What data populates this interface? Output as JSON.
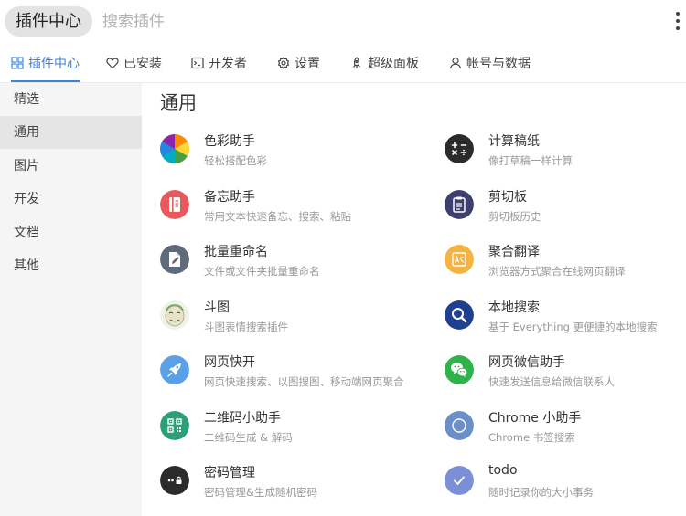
{
  "header": {
    "badge": "插件中心",
    "search_placeholder": "搜索插件"
  },
  "tabs": [
    {
      "label": "插件中心",
      "icon": "grid-icon"
    },
    {
      "label": "已安装",
      "icon": "heart-icon"
    },
    {
      "label": "开发者",
      "icon": "terminal-icon"
    },
    {
      "label": "设置",
      "icon": "gear-icon"
    },
    {
      "label": "超级面板",
      "icon": "rocket-icon"
    },
    {
      "label": "帐号与数据",
      "icon": "user-icon"
    }
  ],
  "sidebar": {
    "items": [
      {
        "label": "精选"
      },
      {
        "label": "通用"
      },
      {
        "label": "图片"
      },
      {
        "label": "开发"
      },
      {
        "label": "文档"
      },
      {
        "label": "其他"
      }
    ]
  },
  "main": {
    "title": "通用",
    "plugins": [
      {
        "name": "色彩助手",
        "desc": "轻松搭配色彩",
        "icon": "color-wheel-icon"
      },
      {
        "name": "计算稿纸",
        "desc": "像打草稿一样计算",
        "icon": "calculator-icon"
      },
      {
        "name": "备忘助手",
        "desc": "常用文本快速备忘、搜索、粘贴",
        "icon": "notebook-icon"
      },
      {
        "name": "剪切板",
        "desc": "剪切板历史",
        "icon": "clipboard-icon"
      },
      {
        "name": "批量重命名",
        "desc": "文件或文件夹批量重命名",
        "icon": "rename-file-icon"
      },
      {
        "name": "聚合翻译",
        "desc": "浏览器方式聚合在线网页翻译",
        "icon": "translate-icon"
      },
      {
        "name": "斗图",
        "desc": "斗图表情搜索插件",
        "icon": "meme-face-icon"
      },
      {
        "name": "本地搜索",
        "desc": "基于 Everything 更便捷的本地搜索",
        "icon": "magnifier-icon"
      },
      {
        "name": "网页快开",
        "desc": "网页快速搜索、以图搜图、移动端网页聚合",
        "icon": "rocket-icon"
      },
      {
        "name": "网页微信助手",
        "desc": "快速发送信息给微信联系人",
        "icon": "wechat-icon"
      },
      {
        "name": "二维码小助手",
        "desc": "二维码生成 & 解码",
        "icon": "qr-code-icon"
      },
      {
        "name": "Chrome 小助手",
        "desc": "Chrome 书签搜索",
        "icon": "chrome-icon"
      },
      {
        "name": "密码管理",
        "desc": "密码管理&生成随机密码",
        "icon": "password-icon"
      },
      {
        "name": "todo",
        "desc": "随时记录你的大小事务",
        "icon": "check-icon"
      }
    ]
  }
}
